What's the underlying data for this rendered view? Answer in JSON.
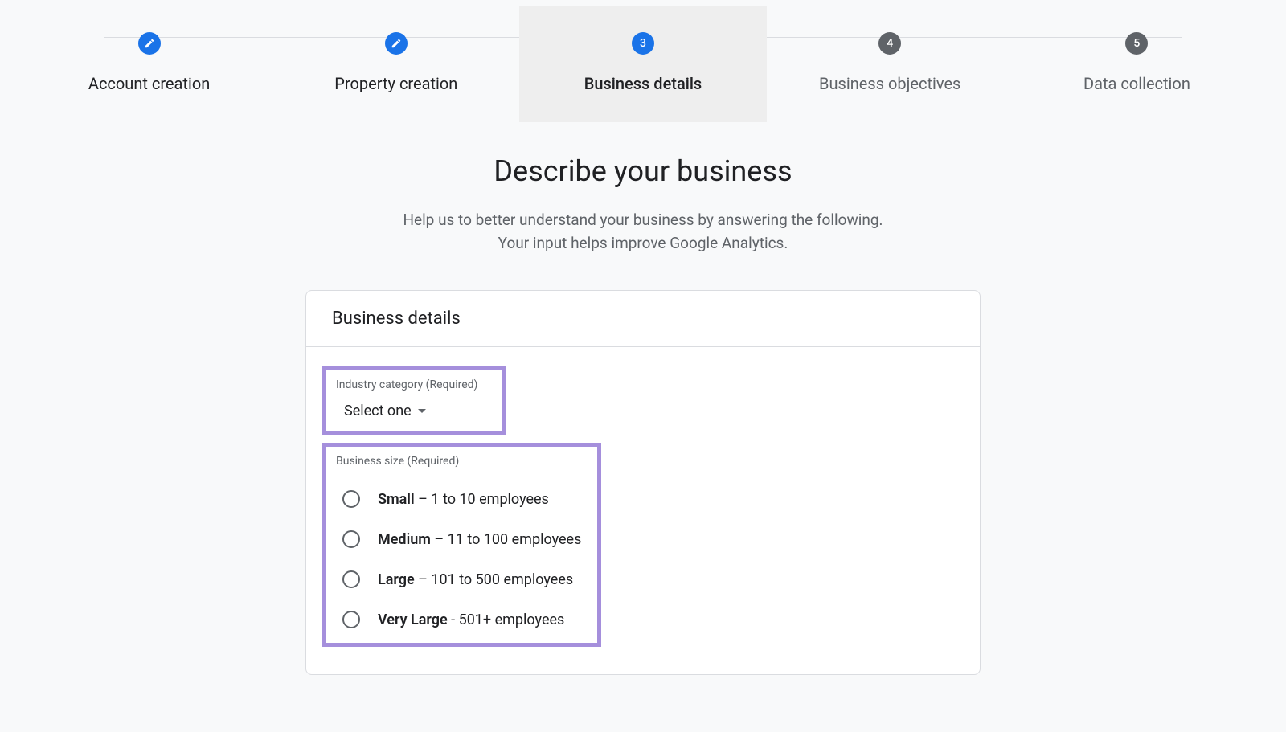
{
  "stepper": {
    "steps": [
      {
        "num": "",
        "label": "Account creation",
        "icon": "pencil"
      },
      {
        "num": "",
        "label": "Property creation",
        "icon": "pencil"
      },
      {
        "num": "3",
        "label": "Business details"
      },
      {
        "num": "4",
        "label": "Business objectives"
      },
      {
        "num": "5",
        "label": "Data collection"
      }
    ]
  },
  "header": {
    "title": "Describe your business",
    "subtitle_line1": "Help us to better understand your business by answering the following.",
    "subtitle_line2": "Your input helps improve Google Analytics."
  },
  "card": {
    "title": "Business details",
    "industry": {
      "label": "Industry category (Required)",
      "selected": "Select one"
    },
    "size": {
      "label": "Business size (Required)",
      "options": [
        {
          "bold": "Small",
          "rest": " – 1 to 10 employees"
        },
        {
          "bold": "Medium",
          "rest": " – 11 to 100 employees"
        },
        {
          "bold": "Large",
          "rest": " – 101 to 500 employees"
        },
        {
          "bold": "Very Large",
          "rest": " - 501+ employees"
        }
      ]
    }
  }
}
